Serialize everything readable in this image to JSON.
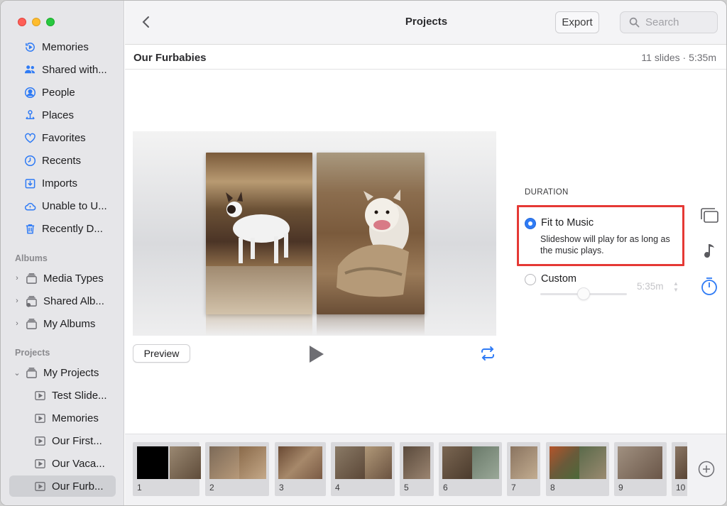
{
  "window": {
    "title": "Projects",
    "export_label": "Export",
    "search_placeholder": "Search"
  },
  "sidebar": {
    "items": [
      {
        "label": "Memories",
        "icon": "memories-icon"
      },
      {
        "label": "Shared with...",
        "icon": "shared-with-you-icon"
      },
      {
        "label": "People",
        "icon": "person-icon"
      },
      {
        "label": "Places",
        "icon": "pin-icon"
      },
      {
        "label": "Favorites",
        "icon": "heart-icon"
      },
      {
        "label": "Recents",
        "icon": "clock-icon"
      },
      {
        "label": "Imports",
        "icon": "import-icon"
      },
      {
        "label": "Unable to U...",
        "icon": "cloud-warning-icon"
      },
      {
        "label": "Recently D...",
        "icon": "trash-icon"
      }
    ],
    "albums_heading": "Albums",
    "albums": [
      {
        "label": "Media Types",
        "icon": "stack-icon"
      },
      {
        "label": "Shared Alb...",
        "icon": "shared-stack-icon"
      },
      {
        "label": "My Albums",
        "icon": "stack-icon"
      }
    ],
    "projects_heading": "Projects",
    "my_projects": "My Projects",
    "projects": [
      {
        "label": "Test Slide..."
      },
      {
        "label": "Memories"
      },
      {
        "label": "Our First..."
      },
      {
        "label": "Our Vaca..."
      },
      {
        "label": "Our Furb...",
        "selected": true
      }
    ]
  },
  "project": {
    "title": "Our Furbabies",
    "meta": "11 slides · 5:35m"
  },
  "controls": {
    "preview_label": "Preview"
  },
  "duration": {
    "heading": "DURATION",
    "fit_title": "Fit to Music",
    "fit_desc": "Slideshow will play for as long as the music plays.",
    "fit_selected": true,
    "custom_title": "Custom",
    "custom_time": "5:35m",
    "highlight_color": "#e53935"
  },
  "filmstrip": {
    "slides": [
      "1",
      "2",
      "3",
      "4",
      "5",
      "6",
      "7",
      "8",
      "9",
      "10"
    ]
  },
  "colors": {
    "accent": "#2f7bf5",
    "sidebar_bg": "#e6e6e9"
  }
}
